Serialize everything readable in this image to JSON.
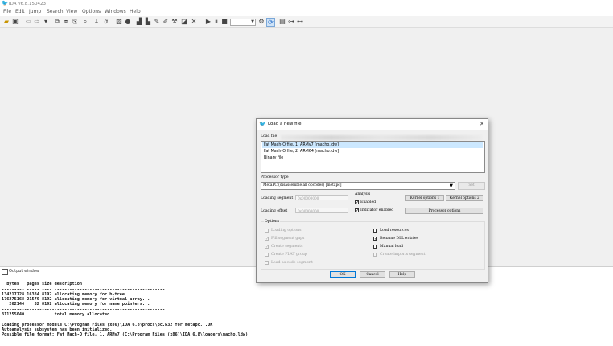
{
  "window": {
    "title": "IDA v6.8.150423"
  },
  "menu": [
    "File",
    "Edit",
    "Jump",
    "Search",
    "View",
    "Options",
    "Windows",
    "Help"
  ],
  "output": {
    "title": "Output window",
    "lines": [
      "",
      "  bytes   pages size description",
      "--------- ----- ---- --------------------------------------------",
      "134217728 16384 8192 allocating memory for b-tree...",
      "176275168 21579 8192 allocating memory for virtual array...",
      "   262144    32 8192 allocating memory for name pointers...",
      "-----------------------------------------------------------------",
      "311255040            total memory allocated",
      "",
      "Loading processor module C:\\Program Files (x86)\\IDA 6.8\\procs\\pc.w32 for metapc...OK",
      "Autoanalysis subsystem has been initialized.",
      "Possible file format: Fat Mach-O file, 1. ARMv7 (C:\\Program Files (x86)\\IDA 6.8\\loaders\\macho.ldw)"
    ]
  },
  "dialog": {
    "title": "Load a new file",
    "load_file_label": "Load file",
    "files": [
      "Fat Mach-O file, 1. ARMv7 [macho.ldw]",
      "Fat Mach-O file, 2. ARM64 [macho.ldw]",
      "Binary file"
    ],
    "processor_type_label": "Processor type",
    "processor_value": "MetaPC (disassemble all opcodes) [metapc]",
    "set_button": "Set",
    "loading_segment_label": "Loading segment",
    "loading_segment_value": "0x00000000",
    "loading_offset_label": "Loading offset",
    "loading_offset_value": "0x00000000",
    "analysis_label": "Analysis",
    "enabled_label": "Enabled",
    "indicator_label": "Indicator enabled",
    "kernel_options_1": "Kernel options 1",
    "kernel_options_2": "Kernel options 2",
    "processor_options": "Processor options",
    "options_label": "Options",
    "opt_loading_options": "Loading options",
    "opt_fill_segment_gaps": "Fill segment gaps",
    "opt_create_segments": "Create segments",
    "opt_create_flat_group": "Create FLAT group",
    "opt_load_as_code_segment": "Load as code segment",
    "opt_load_resources": "Load resources",
    "opt_rename_dll_entries": "Rename DLL entries",
    "opt_manual_load": "Manual load",
    "opt_create_imports_segment": "Create imports segment",
    "ok": "OK",
    "cancel": "Cancel",
    "help": "Help",
    "close_glyph": "✕",
    "check_glyph": "✓"
  },
  "state": {
    "selected_file": 0,
    "enabled_checked": true,
    "indicator_checked": true,
    "fill_segment_gaps_checked": true,
    "create_segments_checked": true,
    "rename_dll_entries_checked": true,
    "load_resources_checked": false,
    "manual_load_checked": false
  }
}
